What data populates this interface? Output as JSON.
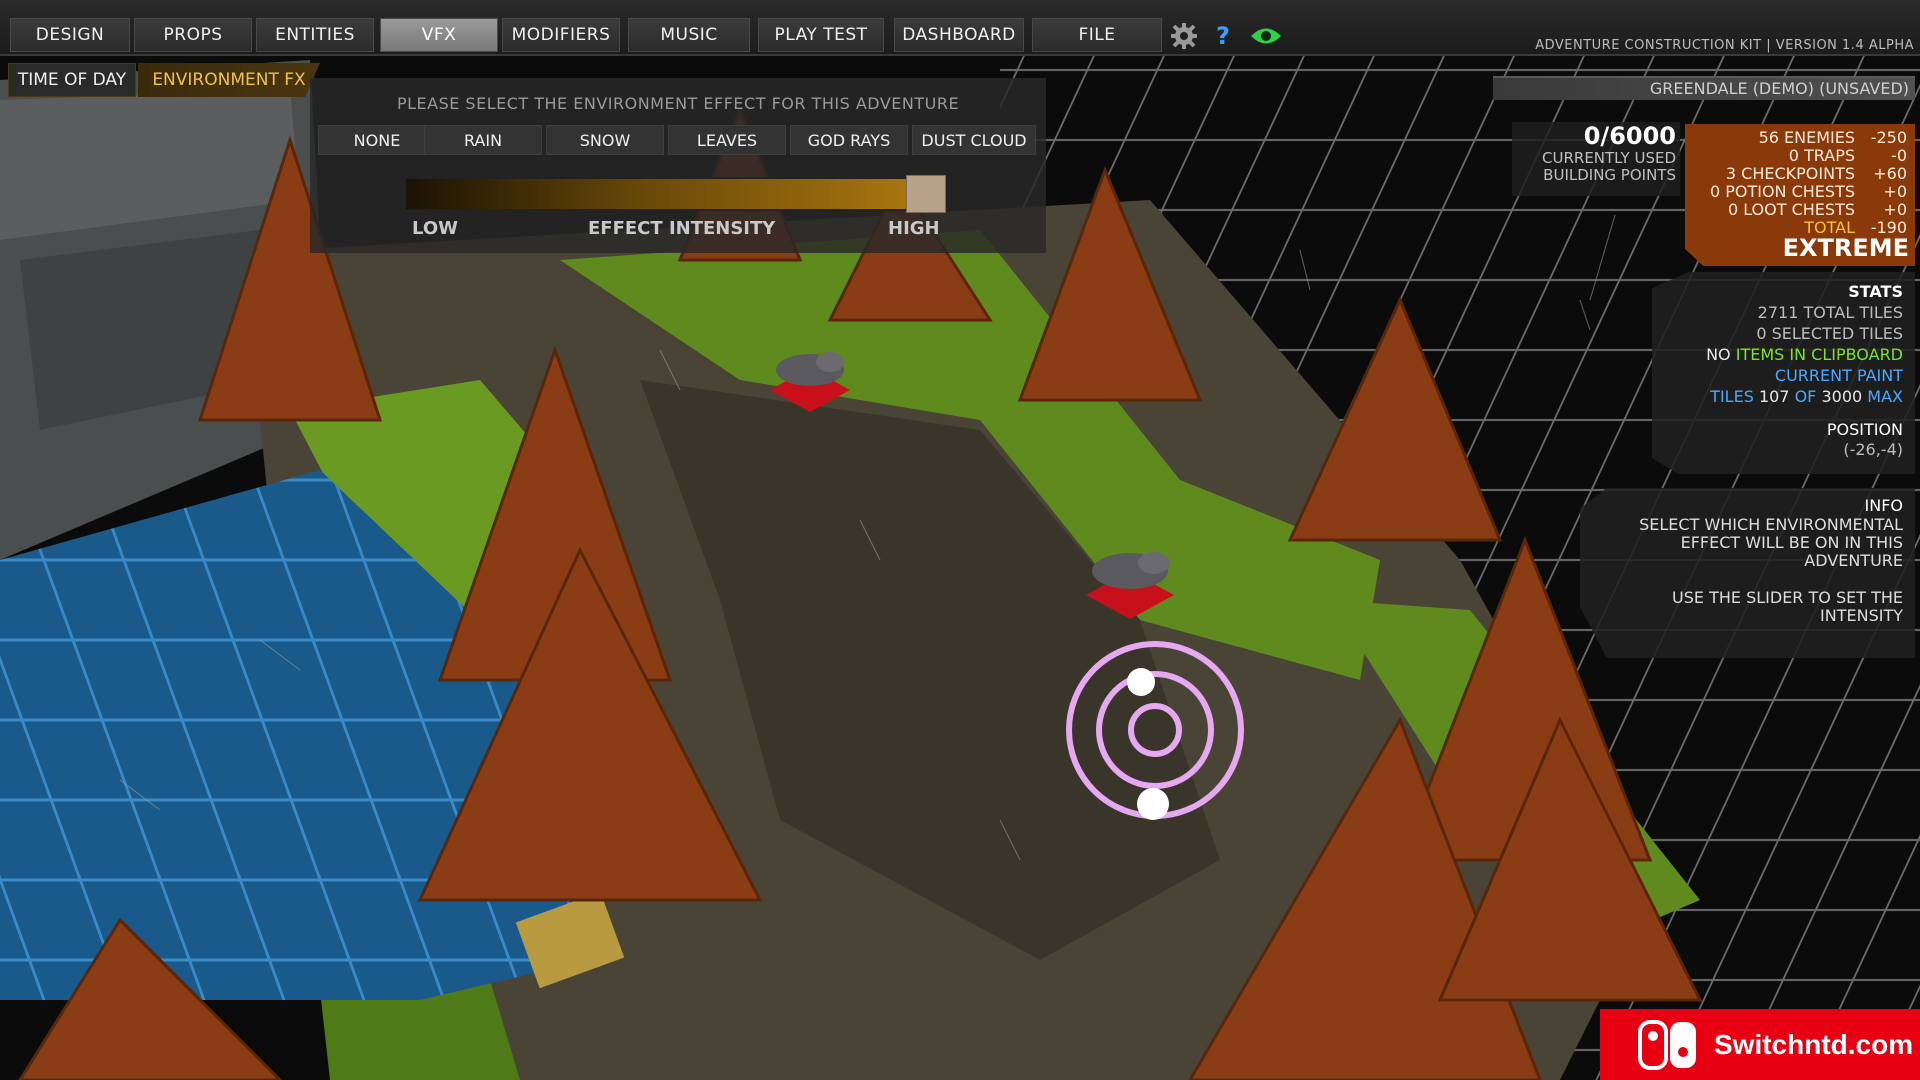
{
  "app": {
    "version": "ADVENTURE CONSTRUCTION KIT | VERSION 1.4 ALPHA",
    "level_name": "GREENDALE (DEMO) (UNSAVED)"
  },
  "menu": {
    "items": [
      {
        "label": "DESIGN",
        "active": false
      },
      {
        "label": "PROPS",
        "active": false
      },
      {
        "label": "ENTITIES",
        "active": false
      },
      {
        "label": "VFX",
        "active": true
      },
      {
        "label": "MODIFIERS",
        "active": false
      },
      {
        "label": "MUSIC",
        "active": false
      },
      {
        "label": "PLAY TEST",
        "active": false
      },
      {
        "label": "DASHBOARD",
        "active": false
      },
      {
        "label": "FILE",
        "active": false
      }
    ],
    "icons": [
      "gear-icon",
      "help-icon",
      "eye-icon"
    ],
    "help_glyph": "?"
  },
  "subtabs": {
    "time_of_day": "TIME OF DAY",
    "environment_fx": "ENVIRONMENT FX"
  },
  "fx_panel": {
    "prompt": "PLEASE SELECT THE ENVIRONMENT EFFECT FOR THIS ADVENTURE",
    "options": [
      "NONE",
      "RAIN",
      "SNOW",
      "LEAVES",
      "GOD RAYS",
      "DUST CLOUD"
    ],
    "selected": "RAIN",
    "slider": {
      "low": "LOW",
      "label": "EFFECT INTENSITY",
      "high": "HIGH",
      "value": 0.95
    }
  },
  "points": {
    "value": "0/6000",
    "caption1": "CURRENTLY USED",
    "caption2": "BUILDING POINTS"
  },
  "difficulty": {
    "rows": [
      {
        "label": "56 ENEMIES",
        "value": "-250"
      },
      {
        "label": "0 TRAPS",
        "value": "-0"
      },
      {
        "label": "3 CHECKPOINTS",
        "value": "+60"
      },
      {
        "label": "0 POTION CHESTS",
        "value": "+0"
      },
      {
        "label": "0 LOOT CHESTS",
        "value": "+0"
      }
    ],
    "total_label": "TOTAL",
    "total_value": "-190",
    "level": "EXTREME"
  },
  "stats": {
    "title": "STATS",
    "total_tiles": "2711 TOTAL TILES",
    "selected_tiles": "0 SELECTED TILES",
    "clipboard_no": "NO",
    "clipboard_rest": "ITEMS IN CLIPBOARD",
    "current_paint": "CURRENT PAINT",
    "tiles_word": "TILES",
    "tiles_used": "107",
    "of_word": "OF",
    "tiles_max": "3000",
    "max_word": "MAX",
    "position_label": "POSITION",
    "position_value": "(-26,-4)"
  },
  "info": {
    "title": "INFO",
    "line1": "SELECT WHICH ENVIRONMENTAL",
    "line2": "EFFECT WILL BE ON IN THIS",
    "line3": "ADVENTURE",
    "line4": "USE THE SLIDER TO SET THE",
    "line5": "INTENSITY"
  },
  "watermark": {
    "text": "Switchntd.com"
  },
  "colors": {
    "accent_orange": "#f0c24a",
    "difficulty_bg": "#8a3a0a",
    "clipboard_green": "#7ee22a",
    "paint_blue": "#4aa8ff",
    "brand_red": "#e60012"
  }
}
